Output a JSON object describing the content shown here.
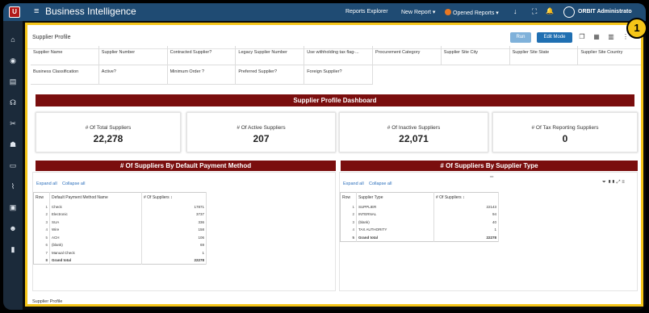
{
  "app": {
    "logo_text": "U",
    "title": "Business Intelligence"
  },
  "topbar": {
    "reports_explorer": "Reports Explorer",
    "new_report": "New Report ▾",
    "opened_reports": "Opened Reports ▾",
    "opened_count": "1",
    "user": "ORBIT Administrato"
  },
  "callout": {
    "number": "1"
  },
  "header": {
    "title": "Supplier Profile",
    "run_label": "Run",
    "edit_label": "Edit Mode"
  },
  "filters": {
    "row1": [
      "Supplier Name",
      "Supplier Number",
      "Contracted Supplier?",
      "Legacy Supplier Number",
      "Use withholding tax flag-...",
      "Procurement Category",
      "Supplier Site City",
      "Supplier Site State",
      "Supplier Site Country"
    ],
    "row2": [
      "Business Classification",
      "Active?",
      "Minimum Order ?",
      "Preferred Supplier?",
      "Foreign Supplier?"
    ]
  },
  "dashboard": {
    "title": "Supplier Profile Dashboard"
  },
  "kpis": [
    {
      "label": "# Of Total Suppliers",
      "value": "22,278"
    },
    {
      "label": "# Of Active Suppliers",
      "value": "207"
    },
    {
      "label": "# Of Inactive Suppliers",
      "value": "22,071"
    },
    {
      "label": "# Of Tax Reporting Suppliers",
      "value": "0"
    }
  ],
  "left_panel": {
    "title": "# Of Suppliers By Default Payment Method",
    "expand": "Expand all",
    "collapse": "Collapse all",
    "headers": [
      "Row",
      "Default Payment Method Name",
      "# Of Suppliers ↕"
    ],
    "rows": [
      [
        "1",
        "Check",
        "17871"
      ],
      [
        "2",
        "Electronic",
        "3737"
      ],
      [
        "3",
        "SUA",
        "336"
      ],
      [
        "4",
        "Wire",
        "158"
      ],
      [
        "5",
        "ACH",
        "106"
      ],
      [
        "6",
        "(blank)",
        "69"
      ],
      [
        "7",
        "Manual Check",
        "1"
      ],
      [
        "8",
        "Grand total",
        "22278"
      ]
    ]
  },
  "right_panel": {
    "title": "# Of Suppliers By Supplier Type",
    "expand": "Expand all",
    "collapse": "Collapse all",
    "headers": [
      "Row",
      "Supplier Type",
      "# Of Suppliers ↕"
    ],
    "rows": [
      [
        "1",
        "SUPPLIER",
        "22143"
      ],
      [
        "2",
        "INTERNAL",
        "94"
      ],
      [
        "3",
        "(blank)",
        "40"
      ],
      [
        "4",
        "TAX AUTHORITY",
        "1"
      ],
      [
        "5",
        "Grand total",
        "22278"
      ]
    ]
  },
  "footer": {
    "label": "Supplier Profile"
  }
}
